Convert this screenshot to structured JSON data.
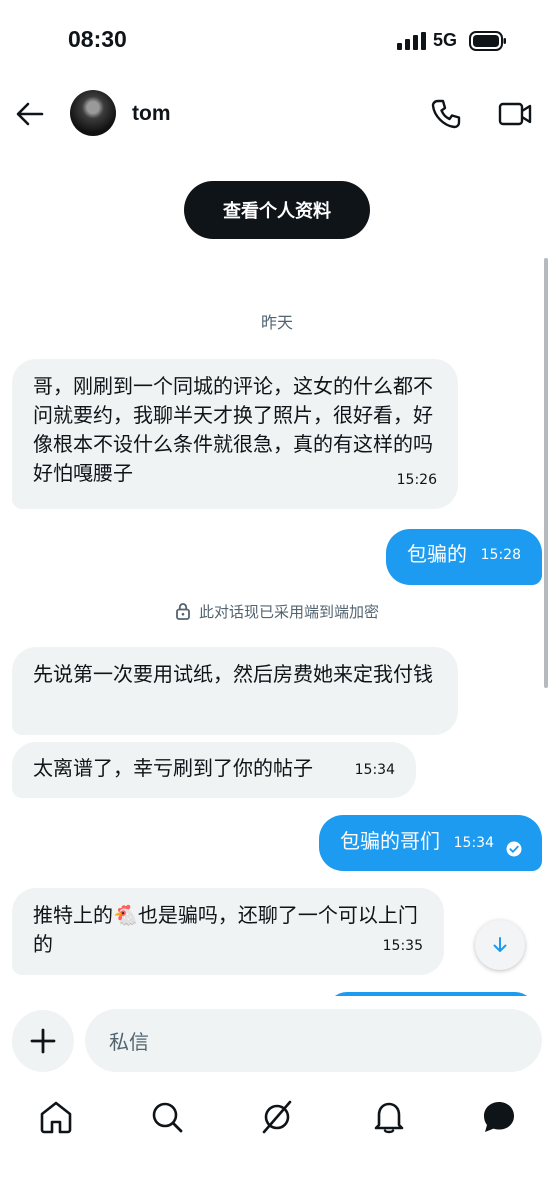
{
  "status_bar": {
    "time": "08:30",
    "network": "5G"
  },
  "header": {
    "contact_name": "tom"
  },
  "profile_button_label": "查看个人资料",
  "date_separator": "昨天",
  "encryption_notice": "此对话现已采用端到端加密",
  "messages": [
    {
      "direction": "in",
      "text": "哥，刚刷到一个同城的评论，这女的什么都不问就要约，我聊半天才换了照片，很好看，好像根本不设什么条件就很急，真的有这样的吗好怕嘎腰子",
      "time": "15:26"
    },
    {
      "direction": "out",
      "text": "包骗的",
      "time": "15:28"
    },
    {
      "direction": "in",
      "text": "先说第一次要用试纸，然后房费她来定我付钱",
      "time": ""
    },
    {
      "direction": "in",
      "text": "太离谱了，幸亏刷到了你的帖子",
      "time": "15:34"
    },
    {
      "direction": "out",
      "text": "包骗的哥们",
      "time": "15:34",
      "read": true
    },
    {
      "direction": "in",
      "text": "推特上的🐔也是骗吗，还聊了一个可以上门的",
      "time": "15:35"
    }
  ],
  "composer": {
    "placeholder": "私信"
  },
  "colors": {
    "accent": "#1d9bf0",
    "incoming_bubble": "#eff3f4",
    "text": "#0f1419",
    "muted": "#536471"
  },
  "icons": [
    "back-arrow-icon",
    "phone-icon",
    "video-icon",
    "lock-icon",
    "arrow-down-icon",
    "plus-icon",
    "home-icon",
    "search-icon",
    "grok-icon",
    "bell-icon",
    "chat-icon"
  ]
}
